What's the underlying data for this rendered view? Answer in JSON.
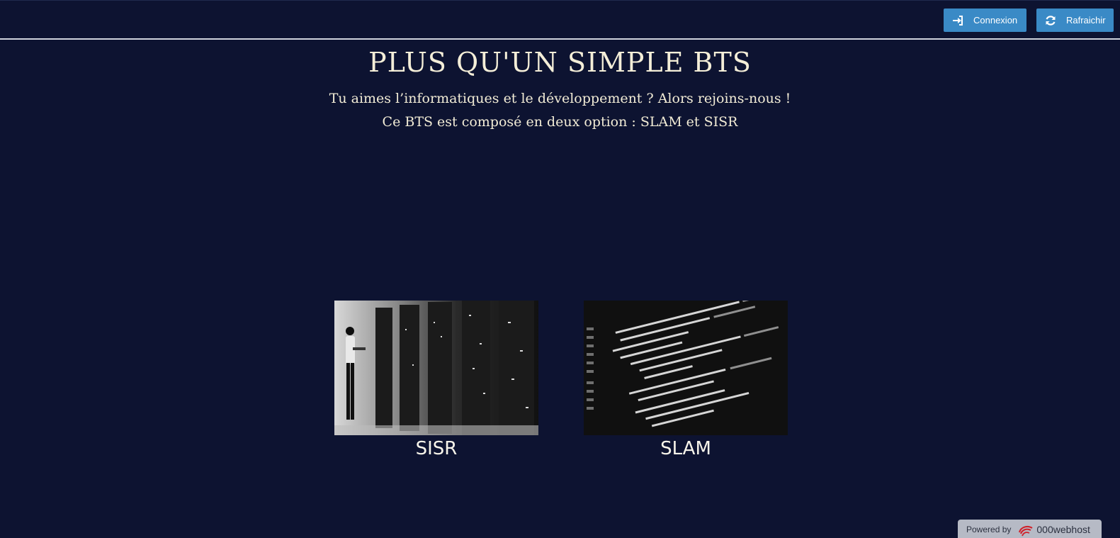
{
  "header": {
    "login_label": "Connexion",
    "refresh_label": "Rafraichir",
    "login_icon": "sign-in-icon",
    "refresh_icon": "refresh-icon",
    "button_color": "#3a8ac6"
  },
  "hero": {
    "title": "PLUS QU'UN SIMPLE BTS",
    "line1": "Tu aimes l’informatiques et le développement ? Alors rejoins-nous !",
    "line2": "Ce BTS est composé en deux option : SLAM et SISR"
  },
  "options": [
    {
      "caption": "SISR",
      "image": "server-room-photo"
    },
    {
      "caption": "SLAM",
      "image": "code-screen-photo"
    }
  ],
  "footer": {
    "powered_label": "Powered by",
    "brand": "000webhost"
  },
  "colors": {
    "background": "#0d1331",
    "text": "#f2ecd6"
  }
}
